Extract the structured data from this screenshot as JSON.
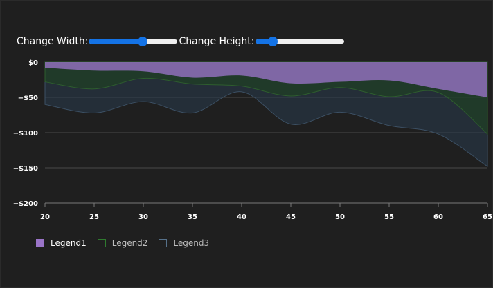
{
  "controls": {
    "width_label": "Change Width:",
    "width_value": 0.62,
    "height_label": "Change Height:",
    "height_value": 0.16
  },
  "chart_data": {
    "type": "area",
    "x": [
      20,
      25,
      30,
      35,
      40,
      45,
      50,
      55,
      60,
      65
    ],
    "xlim": [
      20,
      65
    ],
    "ylim": [
      -200,
      0
    ],
    "y_ticks": [
      0,
      -50,
      -100,
      -150,
      -200
    ],
    "y_tick_labels": [
      "$0",
      "−$50",
      "−$100",
      "−$150",
      "−$200"
    ],
    "x_tick_labels": [
      "20",
      "25",
      "30",
      "35",
      "40",
      "45",
      "50",
      "55",
      "60",
      "65"
    ],
    "grid": true,
    "legend_position": "bottom-left",
    "series": [
      {
        "name": "Legend1",
        "color": "#9a74c8",
        "values": [
          -8,
          -12,
          -13,
          -22,
          -19,
          -30,
          -28,
          -26,
          -38,
          -50
        ]
      },
      {
        "name": "Legend2",
        "color": "#2a6e2a",
        "values": [
          -28,
          -38,
          -23,
          -31,
          -34,
          -48,
          -36,
          -49,
          -43,
          -102
        ]
      },
      {
        "name": "Legend3",
        "color": "#5a7690",
        "values": [
          -60,
          -72,
          -56,
          -72,
          -42,
          -88,
          -71,
          -90,
          -102,
          -148
        ]
      }
    ]
  }
}
